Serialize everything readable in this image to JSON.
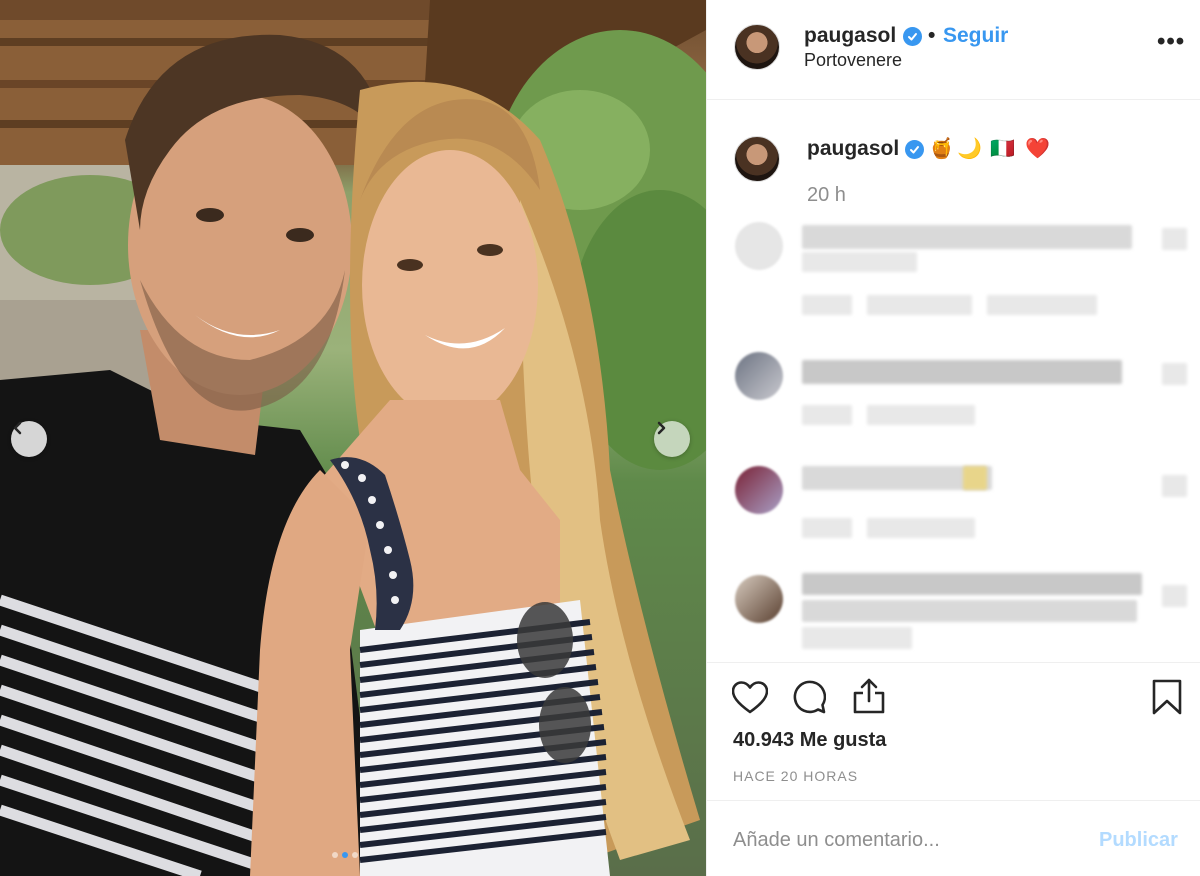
{
  "post": {
    "username": "paugasol",
    "follow_label": "Seguir",
    "bullet": "•",
    "location": "Portovenere",
    "more_label": "•••"
  },
  "caption": {
    "username": "paugasol",
    "emojis": [
      "🍯",
      "🌙",
      "🇮🇹",
      "❤️"
    ],
    "time": "20 h"
  },
  "stats": {
    "likes": "40.943 Me gusta",
    "time_ago": "HACE 20 HORAS"
  },
  "comment": {
    "placeholder": "Añade un comentario...",
    "publish_label": "Publicar"
  },
  "carousel": {
    "slides": 3,
    "active": 2
  },
  "colors": {
    "accent": "#3897f0",
    "text": "#262626",
    "muted": "#8e8e8e",
    "publish_disabled": "#b3dbff"
  },
  "icons": [
    "chevron-left-icon",
    "chevron-right-icon",
    "verified-badge-icon",
    "heart-icon",
    "comment-icon",
    "share-icon",
    "bookmark-icon"
  ]
}
